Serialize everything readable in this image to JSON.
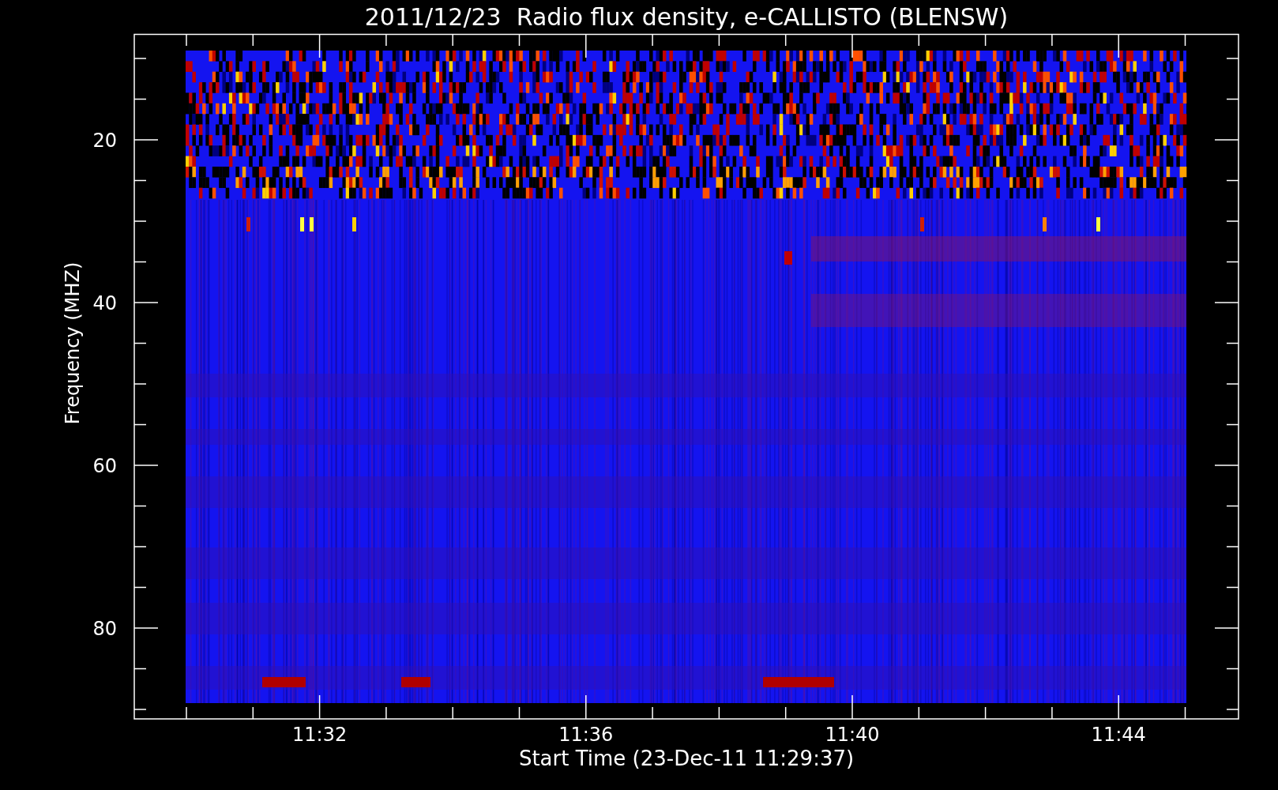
{
  "title": "2011/12/23  Radio flux density, e-CALLISTO (BLENSW)",
  "y_axis": {
    "label": "Frequency (MHZ)",
    "ticks": [
      "20",
      "40",
      "60",
      "80"
    ]
  },
  "x_axis": {
    "label": "Start Time (23-Dec-11 11:29:37)",
    "ticks": [
      "11:32",
      "11:36",
      "11:40",
      "11:44"
    ]
  }
}
